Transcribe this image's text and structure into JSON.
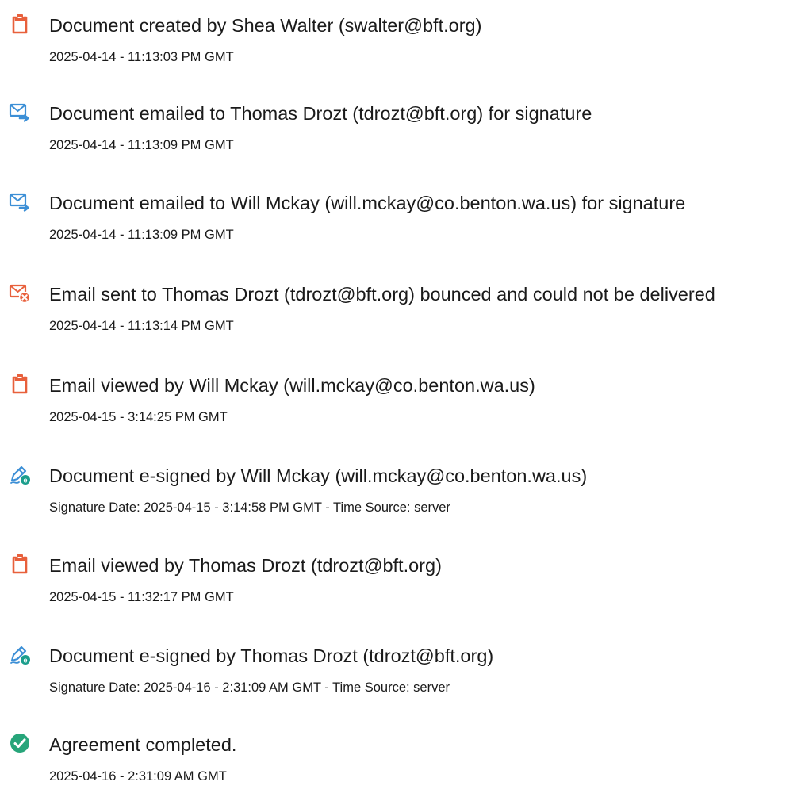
{
  "events": [
    {
      "icon": "document-icon",
      "title": "Document created by Shea Walter (swalter@bft.org)",
      "detail": "2025-04-14 - 11:13:03 PM GMT"
    },
    {
      "icon": "email-sent-icon",
      "title": "Document emailed to Thomas Drozt (tdrozt@bft.org) for signature",
      "detail": "2025-04-14 - 11:13:09 PM GMT"
    },
    {
      "icon": "email-sent-icon",
      "title": "Document emailed to Will Mckay (will.mckay@co.benton.wa.us) for signature",
      "detail": "2025-04-14 - 11:13:09 PM GMT"
    },
    {
      "icon": "email-bounced-icon",
      "title": "Email sent to Thomas Drozt (tdrozt@bft.org) bounced and could not be delivered",
      "detail": "2025-04-14 - 11:13:14 PM GMT"
    },
    {
      "icon": "document-icon",
      "title": "Email viewed by Will Mckay (will.mckay@co.benton.wa.us)",
      "detail": "2025-04-15 - 3:14:25 PM GMT"
    },
    {
      "icon": "esign-pen-icon",
      "title": "Document e-signed by Will Mckay (will.mckay@co.benton.wa.us)",
      "detail": "Signature Date: 2025-04-15 - 3:14:58 PM GMT - Time Source: server"
    },
    {
      "icon": "document-icon",
      "title": "Email viewed by Thomas Drozt (tdrozt@bft.org)",
      "detail": "2025-04-15 - 11:32:17 PM GMT"
    },
    {
      "icon": "esign-pen-icon",
      "title": "Document e-signed by Thomas Drozt (tdrozt@bft.org)",
      "detail": "Signature Date: 2025-04-16 - 2:31:09 AM GMT - Time Source: server"
    },
    {
      "icon": "check-circle-icon",
      "title": "Agreement completed.",
      "detail": "2025-04-16 - 2:31:09 AM GMT"
    }
  ],
  "colors": {
    "document_icon": "#e8603c",
    "email_icon": "#3c8fd6",
    "bounce_badge": "#e8603c",
    "esign_badge": "#1b9e8c",
    "complete_icon": "#27a57a"
  }
}
